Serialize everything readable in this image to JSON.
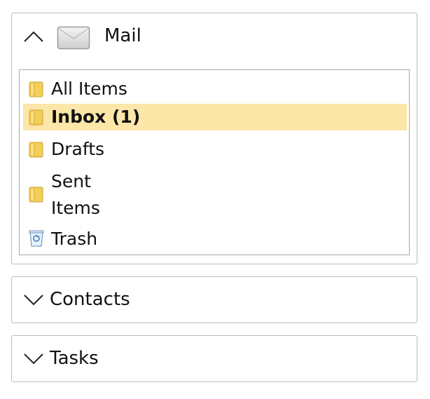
{
  "panels": {
    "mail": {
      "title": "Mail",
      "expanded": true,
      "folders": [
        {
          "label": "All Items",
          "icon": "folder-icon",
          "selected": false
        },
        {
          "label": "Inbox (1)",
          "icon": "folder-icon",
          "selected": true
        },
        {
          "label": "Drafts",
          "icon": "folder-icon",
          "selected": false
        },
        {
          "label": "Sent Items",
          "icon": "folder-icon",
          "selected": false
        },
        {
          "label": "Trash",
          "icon": "trash-icon",
          "selected": false
        }
      ]
    },
    "contacts": {
      "title": "Contacts",
      "expanded": false
    },
    "tasks": {
      "title": "Tasks",
      "expanded": false
    }
  },
  "colors": {
    "selection": "#fde7a8",
    "panel_border": "#bdbdbd",
    "list_border": "#a9a9a9",
    "folder_yellow": "#f2cf5b"
  }
}
